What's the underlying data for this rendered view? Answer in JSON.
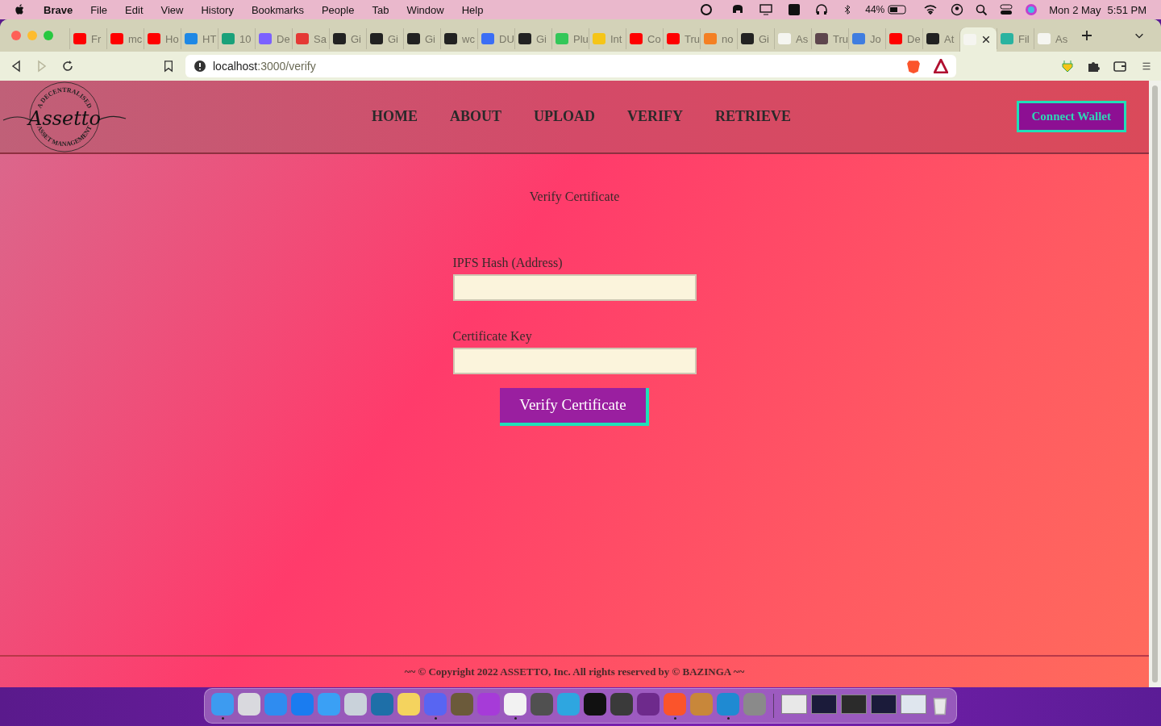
{
  "menu_bar": {
    "app": "Brave",
    "items": [
      "File",
      "Edit",
      "View",
      "History",
      "Bookmarks",
      "People",
      "Tab",
      "Window",
      "Help"
    ],
    "battery": "44%",
    "date": "Mon 2 May",
    "time": "5:51 PM"
  },
  "tabs": [
    {
      "label": "Fr",
      "color": "#ff0000",
      "selected": false
    },
    {
      "label": "mc",
      "color": "#ff0000",
      "selected": false
    },
    {
      "label": "Ho",
      "color": "#ff0000",
      "selected": false
    },
    {
      "label": "HT",
      "color": "#1e88e5",
      "selected": false
    },
    {
      "label": "10",
      "color": "#1aa17a",
      "selected": false
    },
    {
      "label": "De",
      "color": "#7b61ff",
      "selected": false
    },
    {
      "label": "Sa",
      "color": "#e53935",
      "selected": false
    },
    {
      "label": "Gi",
      "color": "#222222",
      "selected": false
    },
    {
      "label": "Gi",
      "color": "#222222",
      "selected": false
    },
    {
      "label": "Gi",
      "color": "#222222",
      "selected": false
    },
    {
      "label": "wc",
      "color": "#222222",
      "selected": false
    },
    {
      "label": "DU",
      "color": "#3b6ef5",
      "selected": false
    },
    {
      "label": "Gi",
      "color": "#222222",
      "selected": false
    },
    {
      "label": "Plu",
      "color": "#34c759",
      "selected": false
    },
    {
      "label": "Int",
      "color": "#f5c518",
      "selected": false
    },
    {
      "label": "Co",
      "color": "#ff0000",
      "selected": false
    },
    {
      "label": "Tru",
      "color": "#ff0000",
      "selected": false
    },
    {
      "label": "no",
      "color": "#f48024",
      "selected": false
    },
    {
      "label": "Gi",
      "color": "#222222",
      "selected": false
    },
    {
      "label": "As",
      "color": "#f5f5f0",
      "selected": false
    },
    {
      "label": "Tru",
      "color": "#5e464d",
      "selected": false
    },
    {
      "label": "Jo",
      "color": "#3f7de0",
      "selected": false
    },
    {
      "label": "De",
      "color": "#ff0000",
      "selected": false
    },
    {
      "label": "At",
      "color": "#222222",
      "selected": false
    },
    {
      "color": "#f5f5f0",
      "selected": true
    },
    {
      "label": "Fil",
      "color": "#2ab3a0",
      "selected": false
    },
    {
      "label": "As",
      "color": "#f5f5f0",
      "selected": false
    }
  ],
  "address_bar": {
    "url_host": "localhost",
    "url_rest": ":3000/verify"
  },
  "logo": {
    "name": "Assetto",
    "top_arc": "A DECENTRALISED",
    "bottom_arc": "ASSET MANAGEMENT"
  },
  "nav": [
    {
      "label": "HOME"
    },
    {
      "label": "ABOUT"
    },
    {
      "label": "UPLOAD"
    },
    {
      "label": "VERIFY"
    },
    {
      "label": "RETRIEVE"
    }
  ],
  "connect_button": "Connect Wallet",
  "form": {
    "title": "Verify Certificate",
    "fields": [
      {
        "label": "IPFS Hash (Address)"
      },
      {
        "label": "Certificate Key"
      }
    ],
    "submit": "Verify Certificate"
  },
  "footer": "~~ © Copyright 2022 ASSETTO, Inc. All rights reserved by © BAZINGA ~~",
  "dock": [
    {
      "color": "#3d9bf0",
      "running": true
    },
    {
      "color": "#d9d9de",
      "running": false
    },
    {
      "color": "#2f8cf0",
      "running": false
    },
    {
      "color": "#1a7cf0",
      "running": false
    },
    {
      "color": "#3aa0f5",
      "running": false
    },
    {
      "color": "#c9d2da",
      "running": false
    },
    {
      "color": "#1e6fa8",
      "running": false
    },
    {
      "color": "#f4d35e",
      "running": false
    },
    {
      "color": "#5865f2",
      "running": true
    },
    {
      "color": "#6b5a3a",
      "running": false
    },
    {
      "color": "#a63bd8",
      "running": false
    },
    {
      "color": "#f2f2f2",
      "running": true
    },
    {
      "color": "#505050",
      "running": false
    },
    {
      "color": "#2ea6e0",
      "running": false
    },
    {
      "color": "#111111",
      "running": false
    },
    {
      "color": "#3a3a3a",
      "running": false
    },
    {
      "color": "#6e2a8c",
      "running": false
    },
    {
      "color": "#fb542b",
      "running": true
    },
    {
      "color": "#c8873a",
      "running": false
    },
    {
      "color": "#1f8ad2",
      "running": true
    },
    {
      "color": "#8a8a8a",
      "running": false
    }
  ],
  "dock_windows": [
    {
      "color": "#e8e8e8"
    },
    {
      "color": "#1b1b3a"
    },
    {
      "color": "#2b2b2b"
    },
    {
      "color": "#1b1b3a"
    },
    {
      "color": "#dfe6ee"
    }
  ]
}
